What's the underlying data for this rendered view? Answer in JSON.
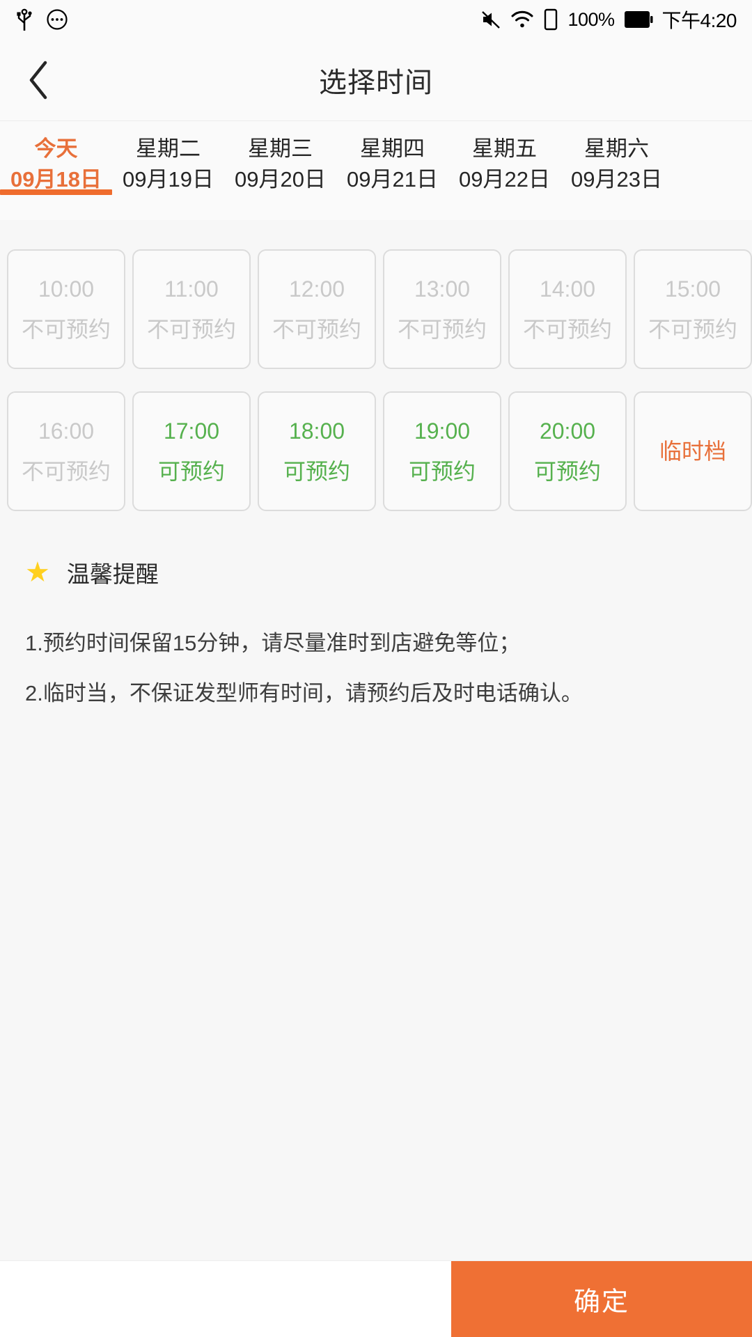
{
  "status_bar": {
    "left_icons": [
      "usb-icon",
      "circle-dots-icon"
    ],
    "right_icons": [
      "mute-icon",
      "wifi-icon",
      "sim-card-icon",
      "battery-icon"
    ],
    "battery_percent": "100%",
    "time": "下午4:20"
  },
  "header": {
    "back_icon": "chevron-left-icon",
    "title": "选择时间"
  },
  "date_tabs": {
    "active_index": 0,
    "items": [
      {
        "day": "今天",
        "date": "09月18日"
      },
      {
        "day": "星期二",
        "date": "09月19日"
      },
      {
        "day": "星期三",
        "date": "09月20日"
      },
      {
        "day": "星期四",
        "date": "09月21日"
      },
      {
        "day": "星期五",
        "date": "09月22日"
      },
      {
        "day": "星期六",
        "date": "09月23日"
      }
    ]
  },
  "slots": [
    {
      "time": "10:00",
      "state": "不可预约",
      "kind": "disabled"
    },
    {
      "time": "11:00",
      "state": "不可预约",
      "kind": "disabled"
    },
    {
      "time": "12:00",
      "state": "不可预约",
      "kind": "disabled"
    },
    {
      "time": "13:00",
      "state": "不可预约",
      "kind": "disabled"
    },
    {
      "time": "14:00",
      "state": "不可预约",
      "kind": "disabled"
    },
    {
      "time": "15:00",
      "state": "不可预约",
      "kind": "disabled"
    },
    {
      "time": "16:00",
      "state": "不可预约",
      "kind": "disabled"
    },
    {
      "time": "17:00",
      "state": "可预约",
      "kind": "available"
    },
    {
      "time": "18:00",
      "state": "可预约",
      "kind": "available"
    },
    {
      "time": "19:00",
      "state": "可预约",
      "kind": "available"
    },
    {
      "time": "20:00",
      "state": "可预约",
      "kind": "available"
    },
    {
      "time": "",
      "state": "临时档",
      "kind": "temp"
    }
  ],
  "notice": {
    "icon": "star-icon",
    "title": "温馨提醒",
    "lines": [
      "1.预约时间保留15分钟，请尽量准时到店避免等位；",
      "2.临时当，不保证发型师有时间，请预约后及时电话确认。"
    ]
  },
  "bottom_bar": {
    "confirm_label": "确定"
  },
  "colors": {
    "accent_orange": "#ef7034",
    "tab_active": "#e8703a",
    "available_green": "#56b14e",
    "disabled_gray": "#c9c9c9",
    "star_yellow": "#ffd01f",
    "page_bg": "#f7f7f7"
  }
}
